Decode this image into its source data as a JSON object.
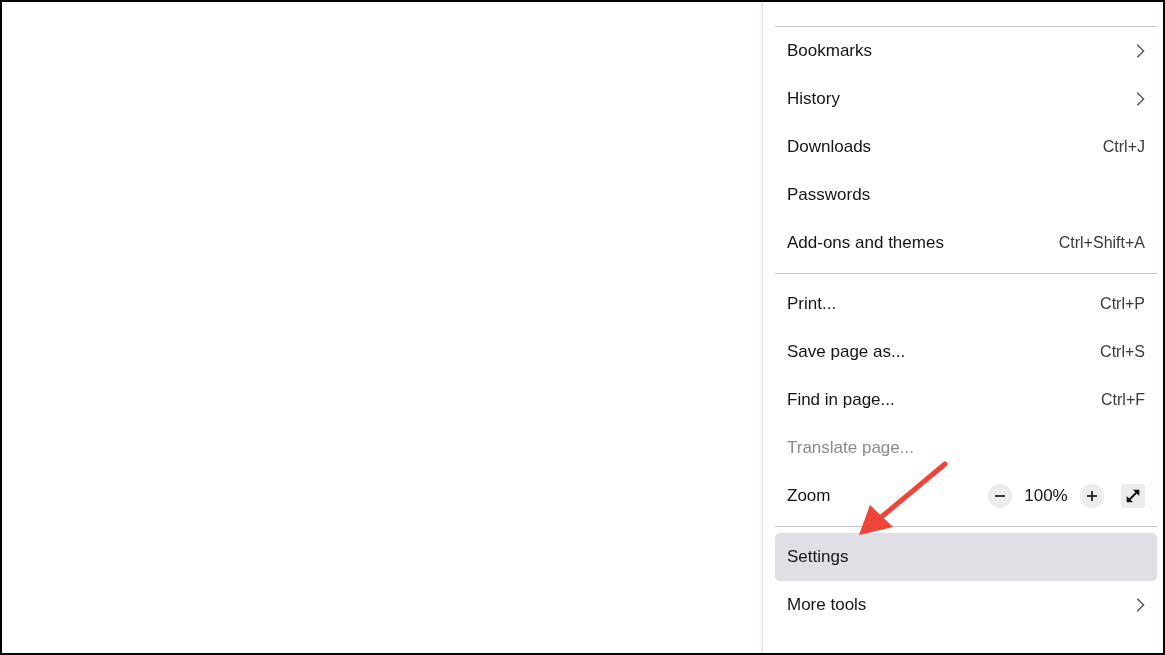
{
  "menu": {
    "sections": [
      [
        {
          "kind": "submenu",
          "label": "Bookmarks",
          "disabled": false,
          "selected": false
        },
        {
          "kind": "submenu",
          "label": "History",
          "disabled": false,
          "selected": false
        },
        {
          "kind": "shortcut",
          "label": "Downloads",
          "shortcut": "Ctrl+J",
          "disabled": false,
          "selected": false
        },
        {
          "kind": "plain",
          "label": "Passwords",
          "disabled": false,
          "selected": false
        },
        {
          "kind": "shortcut",
          "label": "Add-ons and themes",
          "shortcut": "Ctrl+Shift+A",
          "disabled": false,
          "selected": false
        }
      ],
      [
        {
          "kind": "shortcut",
          "label": "Print...",
          "shortcut": "Ctrl+P",
          "disabled": false,
          "selected": false
        },
        {
          "kind": "shortcut",
          "label": "Save page as...",
          "shortcut": "Ctrl+S",
          "disabled": false,
          "selected": false
        },
        {
          "kind": "shortcut",
          "label": "Find in page...",
          "shortcut": "Ctrl+F",
          "disabled": false,
          "selected": false
        },
        {
          "kind": "plain",
          "label": "Translate page...",
          "disabled": true,
          "selected": false
        },
        {
          "kind": "zoom",
          "label": "Zoom",
          "value": "100%",
          "disabled": false,
          "selected": false
        }
      ],
      [
        {
          "kind": "plain",
          "label": "Settings",
          "disabled": false,
          "selected": true
        },
        {
          "kind": "submenu",
          "label": "More tools",
          "disabled": false,
          "selected": false
        }
      ]
    ]
  }
}
